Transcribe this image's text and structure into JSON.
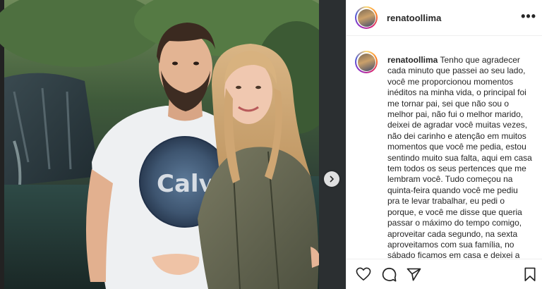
{
  "post": {
    "username": "renatoollima",
    "caption_user": "renatoollima",
    "caption_text": "Tenho que agradecer cada minuto que passei ao seu lado, você me proporcionou momentos inéditos na minha vida, o principal foi me tornar pai, sei que não sou o melhor pai, não fui o melhor marido, deixei de agradar você muitas vezes, não dei carinho e atenção em muitos momentos que você me pedia, estou sentindo muito sua falta, aqui em casa tem todos os seus pertences que me lembram você. Tudo começou na quinta-feira quando você me pediu pra te levar trabalhar, eu pedi o porque, e você me disse que queria passar o máximo do tempo comigo, aproveitar cada segundo, na sexta aproveitamos com sua família, no sábado ficamos em casa e deixei a"
  },
  "photo": {
    "shirt_text": "Calv"
  },
  "icons": {
    "more": "more-options-icon",
    "next": "chevron-right-icon",
    "like": "heart-icon",
    "comment": "comment-icon",
    "share": "paper-plane-icon",
    "save": "bookmark-icon"
  }
}
